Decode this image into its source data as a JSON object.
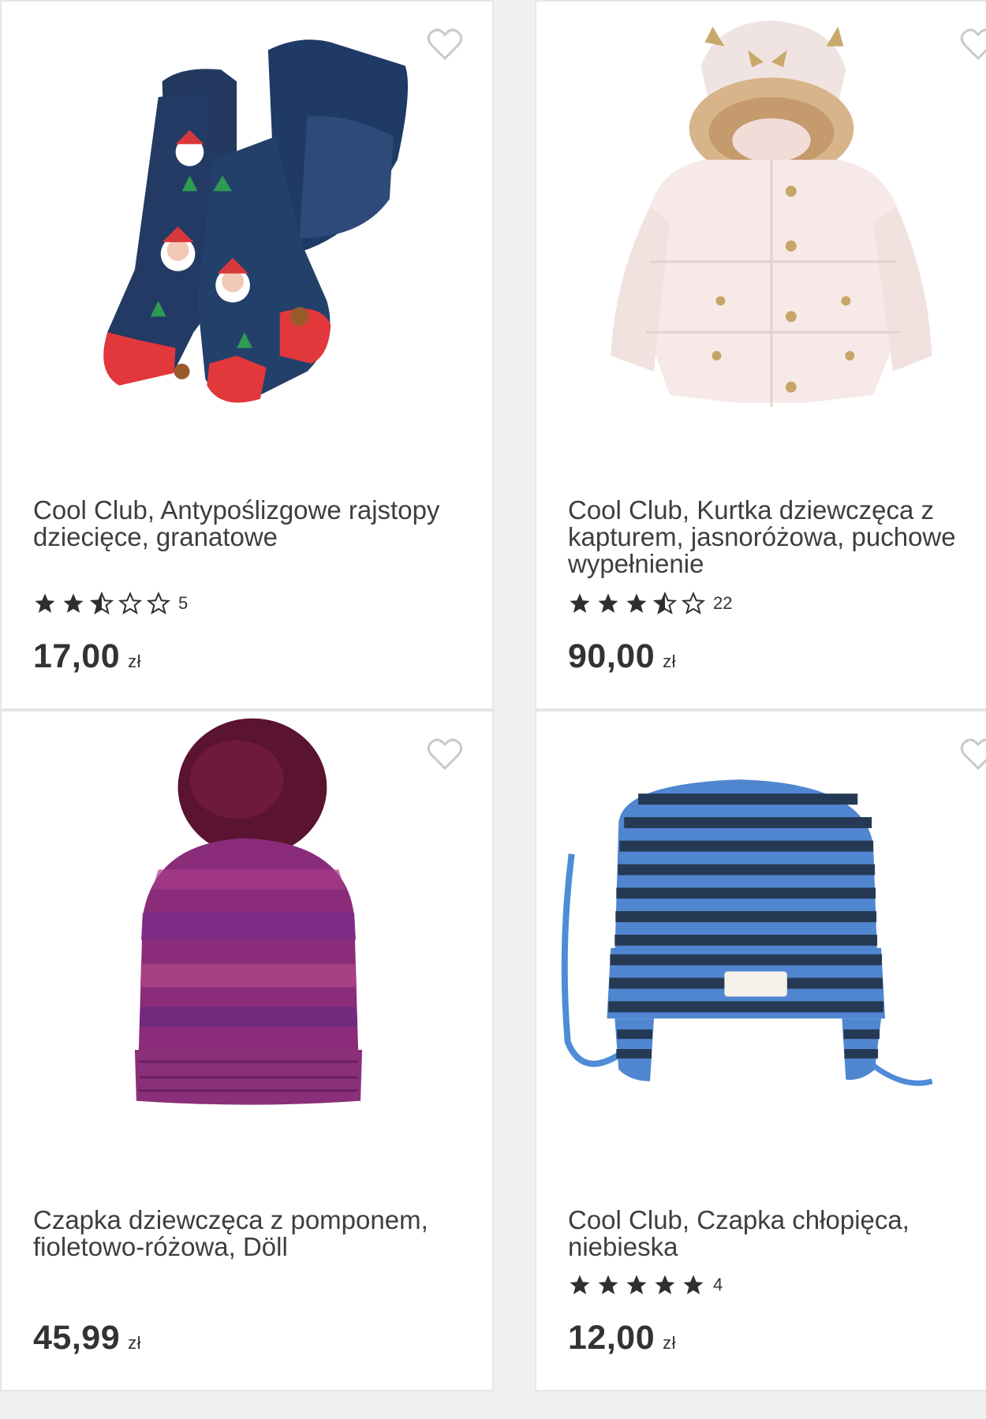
{
  "products": [
    {
      "title_lines": [
        "Cool Club, Antypoślizgowe rajstopy",
        "dziecięce, granatowe"
      ],
      "rating": 2.5,
      "rating_count": "5",
      "price": "17,00",
      "currency": "zł"
    },
    {
      "title_lines": [
        "Cool Club, Kurtka dziewczęca z",
        "kapturem, jasnoróżowa, puchowe",
        "wypełnienie"
      ],
      "rating": 3.5,
      "rating_count": "22",
      "price": "90,00",
      "currency": "zł"
    },
    {
      "title_lines": [
        "Czapka dziewczęca z pomponem,",
        "fioletowo-różowa, Döll"
      ],
      "price": "45,99",
      "currency": "zł"
    },
    {
      "title_lines": [
        "Cool Club, Czapka chłopięca,",
        "niebieska"
      ],
      "rating": 5,
      "rating_count": "4",
      "price": "12,00",
      "currency": "zł"
    }
  ],
  "icons": {
    "wishlist": "heart-outline-icon",
    "star_full": "star-filled-icon",
    "star_half": "star-half-icon",
    "star_empty": "star-outline-icon"
  },
  "colors": {
    "background": "#f0f0f0",
    "card": "#ffffff",
    "text": "#3e3e3e",
    "star": "#2f2f2f"
  }
}
